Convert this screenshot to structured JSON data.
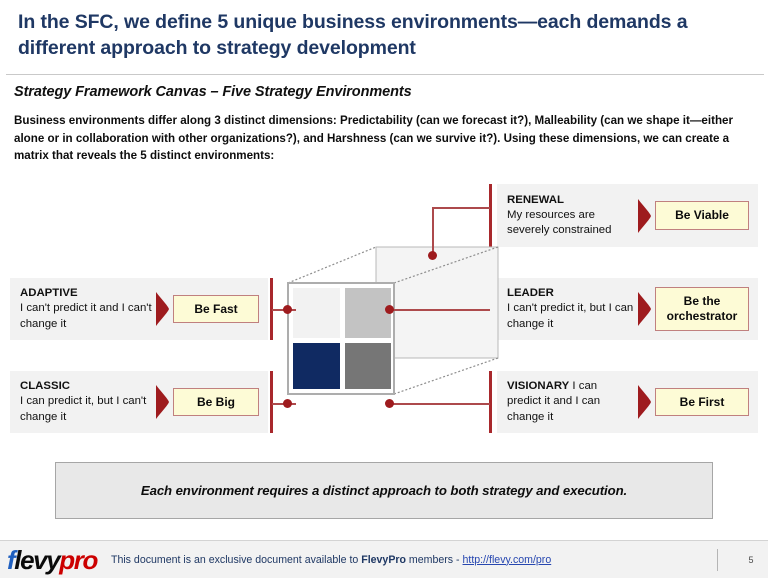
{
  "header": {
    "title": "In the SFC, we define 5 unique business environments—each demands a different approach to strategy development",
    "subtitle": "Strategy Framework Canvas – Five Strategy Environments",
    "lead_copy": "Business environments differ along 3 distinct dimensions:  Predictability (can we forecast it?), Malleability (can we shape it—either alone or in collaboration with other organizations?), and Harshness (can we survive it?).  Using these dimensions, we can create a matrix that reveals the 5 distinct environments:",
    "title_color": "#1F3864"
  },
  "environments": {
    "renewal": {
      "name": "RENEWAL",
      "description": "My resources are severely constrained",
      "action": "Be Viable"
    },
    "adaptive": {
      "name": "ADAPTIVE",
      "description": "I can't predict it and I can't change it",
      "action": "Be Fast"
    },
    "leader": {
      "name": "LEADER",
      "description": "I can't predict it, but I can change it",
      "action": "Be the orchestrator"
    },
    "classic": {
      "name": "CLASSIC",
      "description": "I can predict it, but I can't change it",
      "action": "Be Big"
    },
    "visionary": {
      "name": "VISIONARY",
      "description": " I can predict it and I can change it",
      "action": "Be First"
    }
  },
  "diagram": {
    "quadrant_colors": {
      "top_left": "#F2F2F2",
      "top_right": "#C3C3C3",
      "bottom_left": "#102A62",
      "bottom_right": "#767676",
      "back_face": "#F4F4F4",
      "edge": "#ADADAD"
    },
    "connector_color": "#AD4A4C",
    "rail_color": "#A8282C",
    "node_color": "#9E1B1E"
  },
  "takeaway": {
    "text": "Each environment requires a distinct approach to both strategy and execution."
  },
  "footer": {
    "brand_f": "f",
    "brand_levy": "levy",
    "brand_pro": "pro",
    "note_prefix": "This document is an exclusive document available to ",
    "note_brand": "FlevyPro",
    "note_middle": " members - ",
    "note_link": "http://flevy.com/pro",
    "page_number": "5"
  }
}
